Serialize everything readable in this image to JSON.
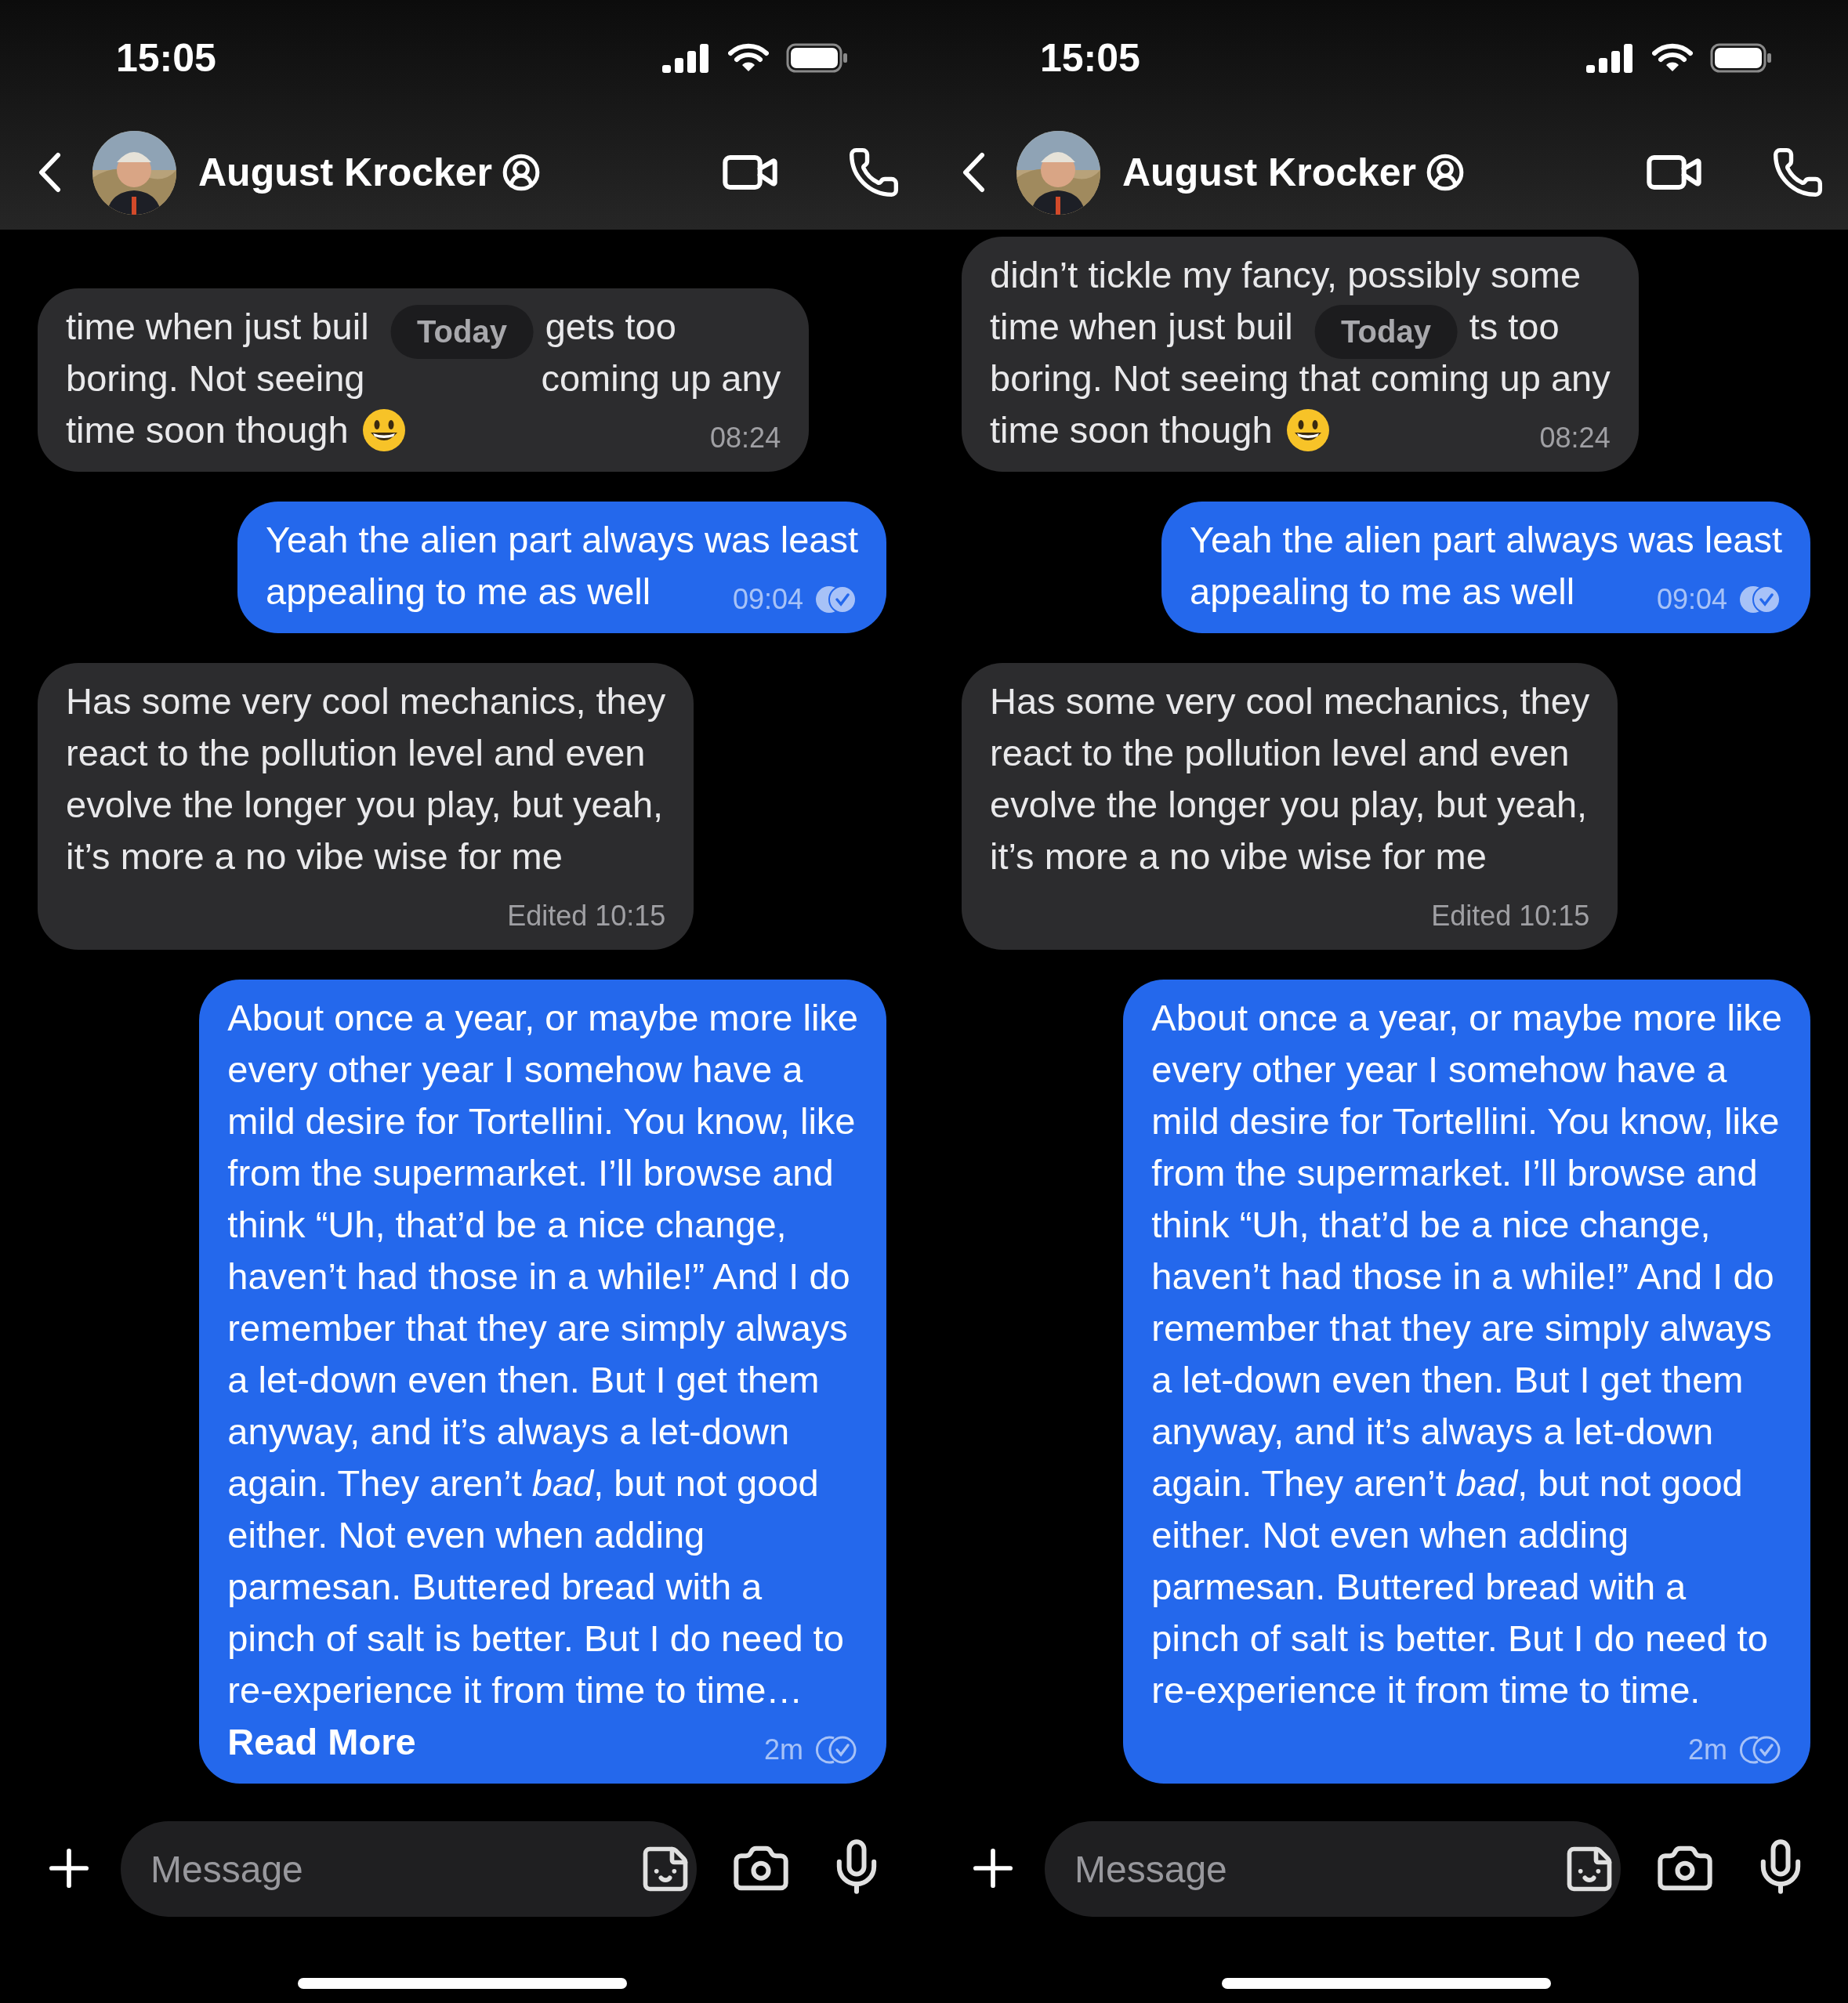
{
  "panes": [
    {
      "status_bar": {
        "time": "15:05"
      },
      "header": {
        "name": "August Krocker"
      },
      "date_pill": "Today",
      "messages": [
        {
          "kind": "incoming",
          "lines": [
            [
              "time when just buil",
              "gets too"
            ],
            [
              "boring. Not seeing",
              "coming up any"
            ],
            [
              "time soon though"
            ]
          ],
          "emoji": true,
          "time": "08:24"
        },
        {
          "kind": "outgoing",
          "lines": [
            [
              "Yeah the alien part always was least"
            ],
            [
              "appealing to me as well"
            ]
          ],
          "time": "09:04",
          "read": true
        },
        {
          "kind": "incoming",
          "lines": [
            [
              "Has some very cool mechanics, they"
            ],
            [
              "react to the pollution level and even"
            ],
            [
              "evolve the longer you play, but yeah,"
            ],
            [
              "it’s more a no vibe wise for me"
            ]
          ],
          "time": "Edited 10:15"
        },
        {
          "kind": "outgoing",
          "lines": [
            [
              "About once a year, or maybe more like"
            ],
            [
              "every other year I somehow have a"
            ],
            [
              "mild desire for Tortellini. You know, like"
            ],
            [
              "from the supermarket. I’ll browse and"
            ],
            [
              "think “Uh, that’d be a nice change,"
            ],
            [
              "haven’t had those in a while!” And I do"
            ],
            [
              "remember that they are simply always"
            ],
            [
              "a let-down even then. But I get them"
            ],
            [
              "anyway, and it’s always a let-down"
            ],
            [
              "again. They aren’t *bad*, but not good"
            ],
            [
              "either. Not even when adding"
            ],
            [
              "parmesan. Buttered bread with a"
            ],
            [
              "pinch of salt is better. But I do need to"
            ],
            [
              "re-experience it from time to time…"
            ]
          ],
          "link": "Read More",
          "time": "2m",
          "read": false
        }
      ],
      "composer": {
        "placeholder": "Message"
      }
    },
    {
      "status_bar": {
        "time": "15:05"
      },
      "header": {
        "name": "August Krocker"
      },
      "date_pill": "Today",
      "messages": [
        {
          "kind": "incoming",
          "lines": [
            [
              "didn’t tickle my fancy, possibly some"
            ],
            [
              "time when just buil",
              "ts too"
            ],
            [
              "boring. Not seeing that coming up any"
            ],
            [
              "time soon though"
            ]
          ],
          "emoji": true,
          "time": "08:24"
        },
        {
          "kind": "outgoing",
          "lines": [
            [
              "Yeah the alien part always was least"
            ],
            [
              "appealing to me as well"
            ]
          ],
          "time": "09:04",
          "read": true
        },
        {
          "kind": "incoming",
          "lines": [
            [
              "Has some very cool mechanics, they"
            ],
            [
              "react to the pollution level and even"
            ],
            [
              "evolve the longer you play, but yeah,"
            ],
            [
              "it’s more a no vibe wise for me"
            ]
          ],
          "time": "Edited 10:15"
        },
        {
          "kind": "outgoing",
          "lines": [
            [
              "About once a year, or maybe more like"
            ],
            [
              "every other year I somehow have a"
            ],
            [
              "mild desire for Tortellini. You know, like"
            ],
            [
              "from the supermarket. I’ll browse and"
            ],
            [
              "think “Uh, that’d be a nice change,"
            ],
            [
              "haven’t had those in a while!” And I do"
            ],
            [
              "remember that they are simply always"
            ],
            [
              "a let-down even then. But I get them"
            ],
            [
              "anyway, and it’s always a let-down"
            ],
            [
              "again. They aren’t *bad*, but not good"
            ],
            [
              "either. Not even when adding"
            ],
            [
              "parmesan. Buttered bread with a"
            ],
            [
              "pinch of salt is better. But I do need to"
            ],
            [
              "re-experience it from time to time."
            ]
          ],
          "time": "2m",
          "read": false
        }
      ],
      "composer": {
        "placeholder": "Message"
      }
    }
  ]
}
